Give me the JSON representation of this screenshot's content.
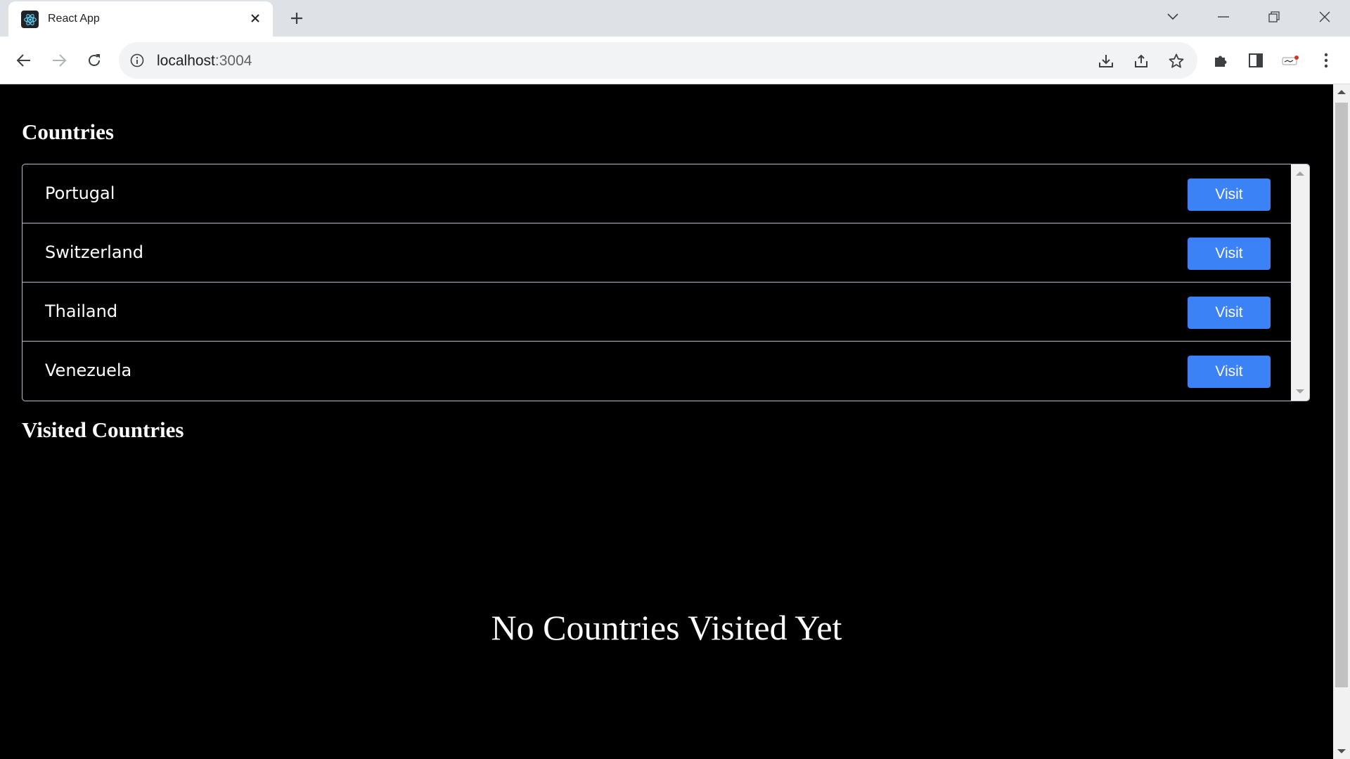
{
  "browser": {
    "tab_title": "React App",
    "url_host": "localhost",
    "url_port": ":3004",
    "icons": {
      "favicon": "react-icon",
      "close_tab": "close-icon",
      "new_tab": "plus-icon",
      "back": "arrow-left-icon",
      "forward": "arrow-right-icon",
      "reload": "reload-icon",
      "site_info": "info-icon",
      "install": "install-icon",
      "share": "share-icon",
      "bookmark": "star-icon",
      "extensions": "puzzle-icon",
      "side_panel": "side-panel-icon",
      "profile": "avatar",
      "menu": "kebab-icon"
    }
  },
  "page": {
    "countries_title": "Countries",
    "countries": [
      {
        "name": "Portugal",
        "action": "Visit"
      },
      {
        "name": "Switzerland",
        "action": "Visit"
      },
      {
        "name": "Thailand",
        "action": "Visit"
      },
      {
        "name": "Venezuela",
        "action": "Visit"
      }
    ],
    "visited_title": "Visited Countries",
    "empty_message": "No Countries Visited Yet"
  },
  "colors": {
    "page_background": "#000000",
    "button_accent": "#3b82f6",
    "list_border": "#b8c0cc"
  }
}
